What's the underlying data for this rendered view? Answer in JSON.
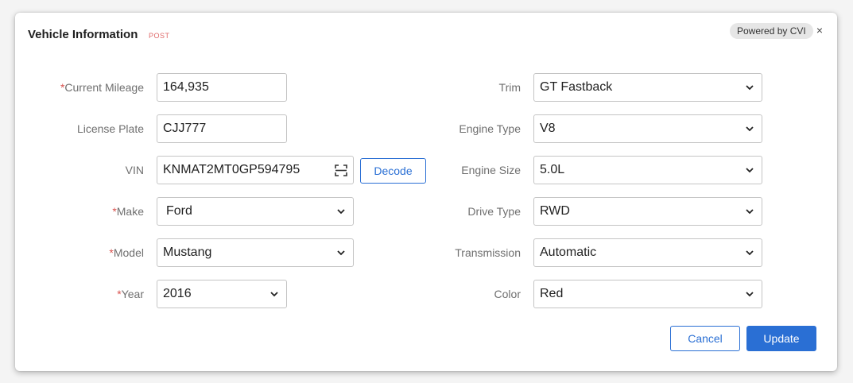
{
  "dialog": {
    "title": "Vehicle Information",
    "tag": "POST",
    "powered_by": "Powered by CVI",
    "close_glyph": "×"
  },
  "left": {
    "mileage": {
      "label": "Current Mileage",
      "required": "*",
      "value": "164,935"
    },
    "plate": {
      "label": "License Plate",
      "value": "CJJ777"
    },
    "vin": {
      "label": "VIN",
      "value": "KNMAT2MT0GP594795",
      "decode_label": "Decode"
    },
    "make": {
      "label": "Make",
      "required": "*",
      "value": "Ford"
    },
    "model": {
      "label": "Model",
      "required": "*",
      "value": "Mustang"
    },
    "year": {
      "label": "Year",
      "required": "*",
      "value": "2016"
    }
  },
  "right": {
    "trim": {
      "label": "Trim",
      "value": "GT Fastback"
    },
    "engine_type": {
      "label": "Engine Type",
      "value": "V8"
    },
    "engine_size": {
      "label": "Engine Size",
      "value": "5.0L"
    },
    "drive_type": {
      "label": "Drive Type",
      "value": "RWD"
    },
    "transmission": {
      "label": "Transmission",
      "value": "Automatic"
    },
    "color": {
      "label": "Color",
      "value": "Red"
    }
  },
  "actions": {
    "cancel_label": "Cancel",
    "update_label": "Update"
  },
  "colors": {
    "accent": "#2a6fd4",
    "required": "#d9534f",
    "tag": "#e06a6a"
  },
  "icons": {
    "close": "close-icon",
    "chevron": "chevron-down-icon",
    "scan": "barcode-scan-icon"
  }
}
